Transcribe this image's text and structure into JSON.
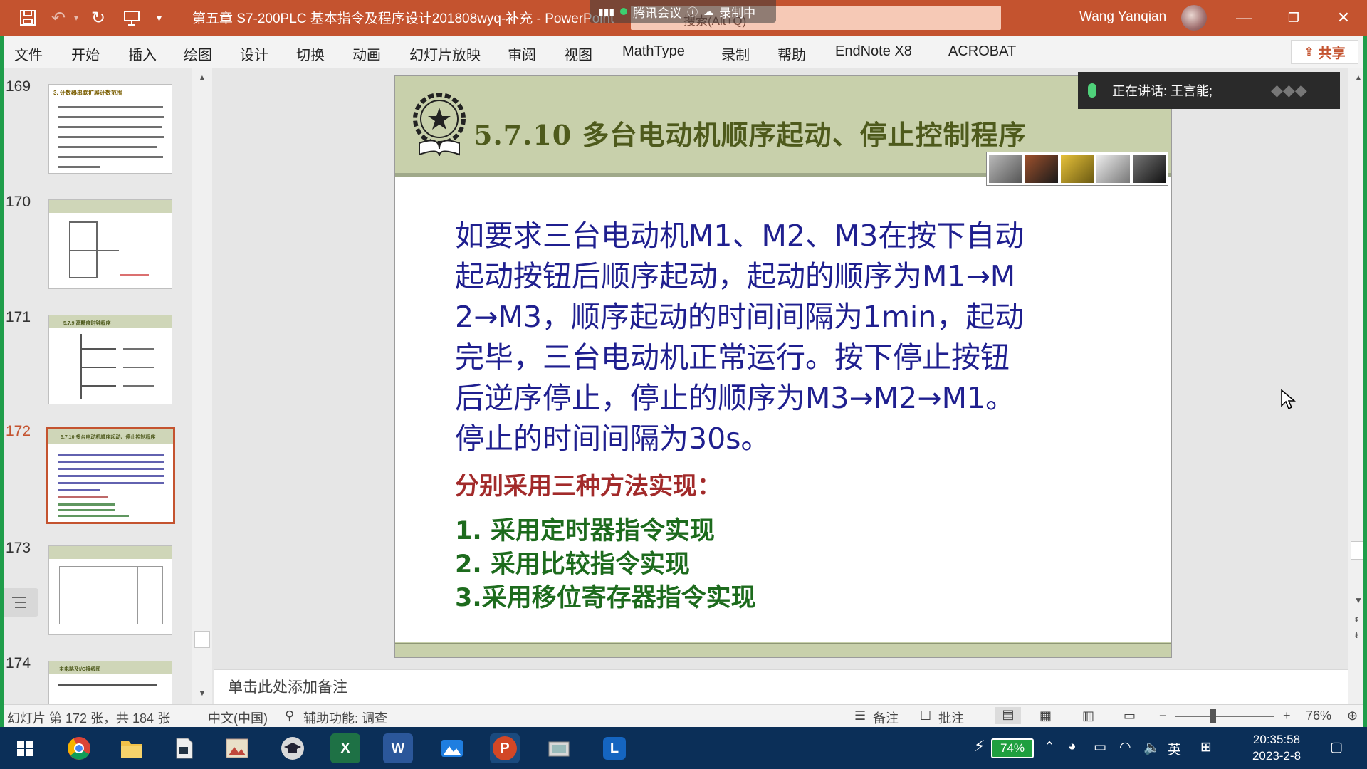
{
  "window": {
    "title": "第五章 S7-200PLC 基本指令及程序设计201808wyq-补充  -  PowerPoint",
    "search_placeholder": "搜索(Alt+Q)",
    "user": "Wang Yanqian",
    "meeting": {
      "app": "腾讯会议",
      "status": "录制中"
    }
  },
  "ribbon_tabs": [
    "文件",
    "开始",
    "插入",
    "绘图",
    "设计",
    "切换",
    "动画",
    "幻灯片放映",
    "审阅",
    "视图",
    "MathType",
    "录制",
    "帮助",
    "EndNote X8",
    "ACROBAT"
  ],
  "share_label": "共享",
  "speaking": "正在讲话: 王言能;",
  "thumbnails": [
    {
      "num": "169",
      "header": "3. 计数器串联扩展计数范围"
    },
    {
      "num": "170",
      "header": ""
    },
    {
      "num": "171",
      "header": "5.7.9  高精度时钟程序"
    },
    {
      "num": "172",
      "header": "5.7.10  多台电动机顺序起动、停止控制程序",
      "active": true
    },
    {
      "num": "173",
      "header": ""
    },
    {
      "num": "174",
      "header": "主电路及I/O接线图"
    }
  ],
  "slide": {
    "title": "5.7.10    多台电动机顺序起动、停止控制程序",
    "body_lines": [
      "如要求三台电动机M1、M2、M3在按下自动",
      "起动按钮后顺序起动，起动的顺序为M1→M",
      "2→M3，顺序起动的时间间隔为1min，起动",
      "完毕，三台电动机正常运行。按下停止按钮",
      "后逆序停止，停止的顺序为M3→M2→M1。",
      "停止的时间间隔为30s。"
    ],
    "emphasis": "分别采用三种方法实现：",
    "methods": [
      "1. 采用定时器指令实现",
      "2. 采用比较指令实现",
      "3.采用移位寄存器指令实现"
    ]
  },
  "notes_placeholder": "单击此处添加备注",
  "status": {
    "slide_info": "幻灯片 第 172 张，共 184 张",
    "language": "中文(中国)",
    "accessibility": "辅助功能: 调查",
    "notes": "备注",
    "comments": "批注",
    "zoom": "76%"
  },
  "taskbar": {
    "battery": "74%",
    "ime": "英",
    "time": "20:35:58",
    "date": "2023-2-8"
  },
  "colors": {
    "titlebar": "#c4532f",
    "slide_header": "#c8d0ab",
    "body_text": "#1f1f8f",
    "emphasis": "#a22a2a",
    "methods": "#1d6b1d",
    "taskbar": "#0b2f58"
  }
}
